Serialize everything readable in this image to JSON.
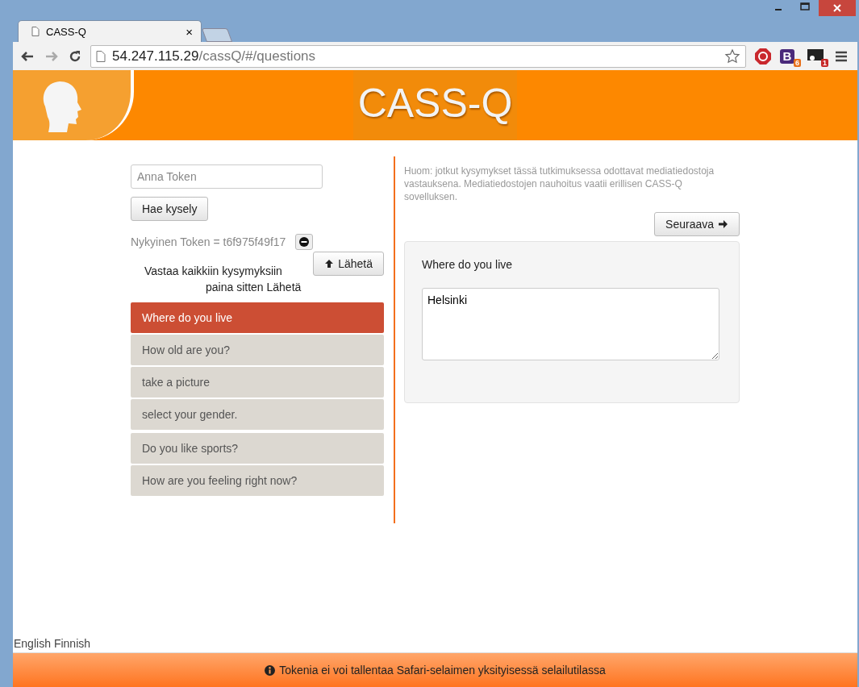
{
  "browser": {
    "tab_title": "CASS-Q",
    "tab_close": "×",
    "url_host": "54.247.115.29",
    "url_path": "/cassQ/#/questions",
    "extensions": [
      {
        "kind": "stop"
      },
      {
        "kind": "letter",
        "label": "B",
        "badge": "6"
      },
      {
        "kind": "screen",
        "badge": "1"
      }
    ]
  },
  "header": {
    "title": "CASS-Q"
  },
  "left": {
    "token_placeholder": "Anna Token",
    "fetch_button": "Hae kysely",
    "current_token": "Nykyinen Token = t6f975f49f17",
    "submit_button": "Lähetä",
    "instruction_lines": [
      "Vastaa kaikkiin kysymyksiin",
      "paina sitten Lähetä"
    ],
    "question_groups": [
      {
        "items": [
          {
            "label": "Where do you live",
            "selected": true
          },
          {
            "label": "How old are you?",
            "selected": false
          },
          {
            "label": "take a picture",
            "selected": false
          },
          {
            "label": "select your gender.",
            "selected": false
          }
        ]
      },
      {
        "items": [
          {
            "label": "Do you like sports?",
            "selected": false
          },
          {
            "label": "How are you feeling right now?",
            "selected": false
          }
        ]
      }
    ]
  },
  "right": {
    "note": "Huom: jotkut kysymykset tässä tutkimuksessa odottavat mediatiedostoja vastauksena. Mediatiedostojen nauhoitus vaatii erillisen CASS-Q sovelluksen.",
    "next_button": "Seuraava",
    "question": "Where do you live",
    "answer": "Helsinki"
  },
  "languages": [
    "English",
    "Finnish"
  ],
  "footer": {
    "notice": "Tokenia ei voi tallentaa Safari-selaimen yksityisessä selailutilassa"
  }
}
